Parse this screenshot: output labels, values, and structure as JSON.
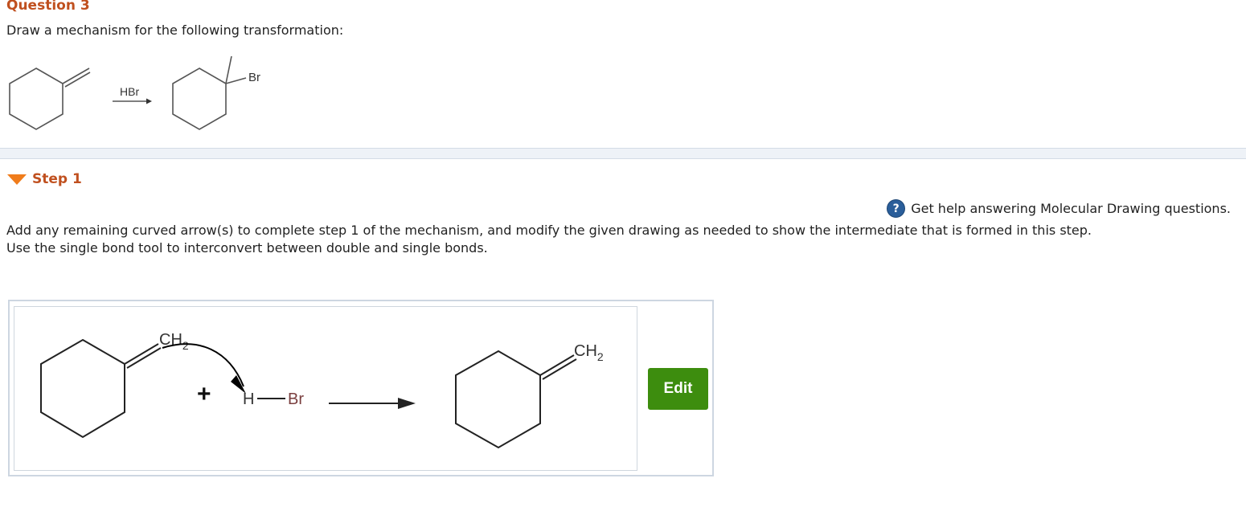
{
  "question": {
    "title": "Question 3",
    "prompt": "Draw a mechanism for the following transformation:"
  },
  "reaction": {
    "reagent": "HBr",
    "product_substituent": "Br"
  },
  "step": {
    "label": "Step 1",
    "help_text": "Get help answering Molecular Drawing questions.",
    "help_icon": "?",
    "instruction_line1": "Add any remaining curved arrow(s) to complete step 1 of the mechanism, and modify the given drawing as needed to show the intermediate that is formed in this step.",
    "instruction_line2": "Use the single bond tool to interconvert between double and single bonds."
  },
  "drawing": {
    "reactant_group": "CH",
    "reactant_group_sub": "2",
    "plus": "+",
    "hbr_h": "H",
    "hbr_br": "Br",
    "product_group": "CH",
    "product_group_sub": "2",
    "bromine_color": "#7a3f3f"
  },
  "edit_button": {
    "label": "Edit"
  },
  "colors": {
    "title": "#c0501f",
    "toggle_triangle": "#f07c1b",
    "help_icon": "#2a5e9a",
    "edit_button": "#3d8d0e"
  }
}
